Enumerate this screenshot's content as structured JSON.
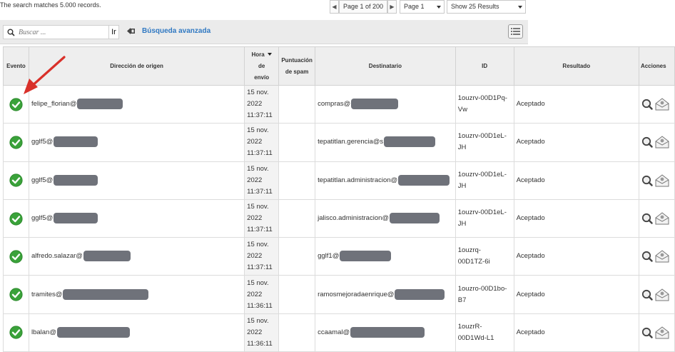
{
  "summary": {
    "text": "The search matches 5.000 records."
  },
  "pager": {
    "prev_label": "◀",
    "page_of_label": "Page 1 of 200",
    "next_label": "▶",
    "page_select": "Page 1",
    "results_select": "Show 25 Results"
  },
  "toolbar": {
    "search_placeholder": "Buscar ...",
    "go_label": "Ir",
    "advanced_label": "Búsqueda avanzada",
    "icons": [
      "search-icon",
      "advanced-search-icon",
      "list-view-icon"
    ]
  },
  "table": {
    "headers": {
      "event": "Evento",
      "source": "Dirección de origen",
      "sent_line1": "Hora",
      "sent_line2": "de",
      "sent_line3": "envío",
      "spam_line1": "Puntuación",
      "spam_line2": "de spam",
      "recipient": "Destinatario",
      "id": "ID",
      "result": "Resultado",
      "actions": "Acciones"
    },
    "rows": [
      {
        "status": "accepted",
        "source_user": "felipe_florian@",
        "date": "15 nov.",
        "year": "2022",
        "time": "11:37:11",
        "spam": "",
        "recipient_user": "compras@",
        "id_line1": "1ouzrv-00D1Pq-",
        "id_line2": "Vw",
        "result": "Aceptado"
      },
      {
        "status": "accepted",
        "source_user": "gglf5@",
        "date": "15 nov.",
        "year": "2022",
        "time": "11:37:11",
        "spam": "",
        "recipient_user": "tepatitlan.gerencia@s",
        "id_line1": "1ouzrv-00D1eL-",
        "id_line2": "JH",
        "result": "Aceptado"
      },
      {
        "status": "accepted",
        "source_user": "gglf5@",
        "date": "15 nov.",
        "year": "2022",
        "time": "11:37:11",
        "spam": "",
        "recipient_user": "tepatitlan.administracion@",
        "id_line1": "1ouzrv-00D1eL-",
        "id_line2": "JH",
        "result": "Aceptado"
      },
      {
        "status": "accepted",
        "source_user": "gglf5@",
        "date": "15 nov.",
        "year": "2022",
        "time": "11:37:11",
        "spam": "",
        "recipient_user": "jalisco.administracion@",
        "id_line1": "1ouzrv-00D1eL-",
        "id_line2": "JH",
        "result": "Aceptado"
      },
      {
        "status": "accepted",
        "source_user": "alfredo.salazar@",
        "date": "15 nov.",
        "year": "2022",
        "time": "11:37:11",
        "spam": "",
        "recipient_user": "gglf1@",
        "id_line1": "1ouzrq-",
        "id_line2": "00D1TZ-6i",
        "result": "Aceptado"
      },
      {
        "status": "accepted",
        "source_user": "tramites@",
        "date": "15 nov.",
        "year": "2022",
        "time": "11:36:11",
        "spam": "",
        "recipient_user": "ramosmejoradaenrique@",
        "id_line1": "1ouzro-00D1bo-",
        "id_line2": "B7",
        "result": "Aceptado"
      },
      {
        "status": "accepted",
        "source_user": "lbalan@",
        "date": "15 nov.",
        "year": "2022",
        "time": "11:36:11",
        "spam": "",
        "recipient_user": "ccaamal@",
        "id_line1": "1ouzrR-",
        "id_line2": "00D1Wd-L1",
        "result": "Aceptado"
      }
    ]
  },
  "colors": {
    "accent_link": "#2f78c2",
    "status_ok": "#3aa23a",
    "annotation_arrow": "#d9302a",
    "redaction": "#6f727a"
  }
}
